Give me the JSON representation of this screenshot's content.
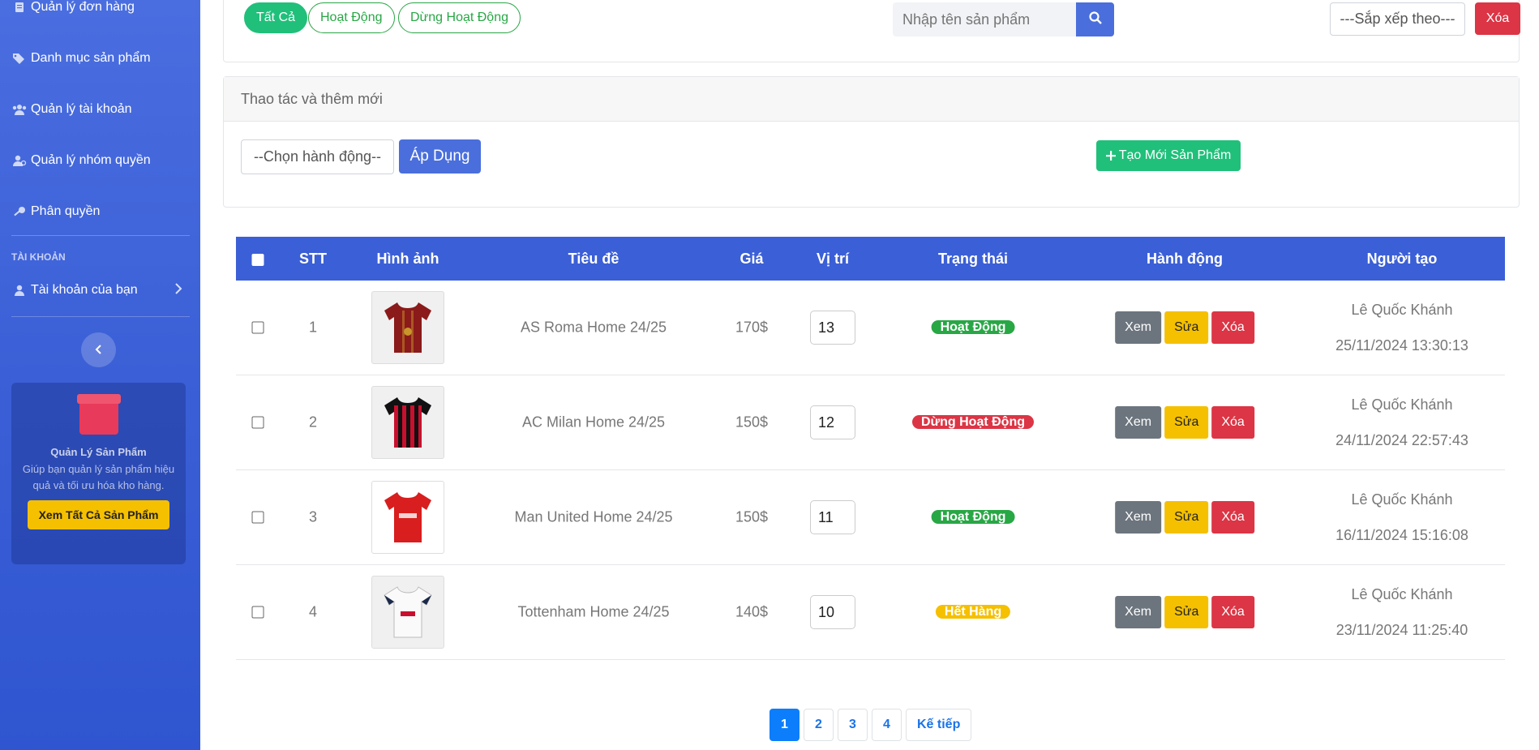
{
  "sidebar": {
    "items": [
      {
        "label": "Quản lý đơn hàng",
        "icon": "order-icon"
      },
      {
        "label": "Danh mục sản phẩm",
        "icon": "tags-icon"
      },
      {
        "label": "Quản lý tài khoản",
        "icon": "users-icon"
      },
      {
        "label": "Quản lý nhóm quyền",
        "icon": "user-group-icon"
      },
      {
        "label": "Phân quyền",
        "icon": "key-icon"
      }
    ],
    "section_label": "TÀI KHOẢN",
    "account_item": "Tài khoản của bạn",
    "collapse_icon": "chevron-left-icon",
    "promo": {
      "title": "Quản Lý Sản Phẩm",
      "description": "Giúp bạn quản lý sản phẩm hiệu quả và tối ưu hóa kho hàng.",
      "button": "Xem Tất Cả Sản Phẩm"
    }
  },
  "filter": {
    "status_buttons": [
      "Tất Cả",
      "Hoạt Động",
      "Dừng Hoạt Động"
    ],
    "active_status": "Tất Cả",
    "search_placeholder": "Nhập tên sản phẩm",
    "sort_placeholder": "---Sắp xếp theo---",
    "clear_label": "Xóa"
  },
  "actions": {
    "heading": "Thao tác và thêm mới",
    "select_placeholder": "--Chọn hành động--",
    "apply_label": "Áp Dụng",
    "create_label": "Tạo Mới Sản Phẩm"
  },
  "table": {
    "headers": [
      "STT",
      "Hình ảnh",
      "Tiêu đề",
      "Giá",
      "Vị trí",
      "Trạng thái",
      "Hành động",
      "Người tạo"
    ],
    "action_labels": {
      "view": "Xem",
      "edit": "Sửa",
      "delete": "Xóa"
    },
    "rows": [
      {
        "stt": "1",
        "title": "AS Roma Home 24/25",
        "price": "170$",
        "position": "13",
        "status": "Hoạt Động",
        "status_color": "#28a745",
        "creator": "Lê Quốc Khánh",
        "created": "25/11/2024 13:30:13",
        "shirt_colors": [
          "#8b1a1a",
          "#c9962a"
        ]
      },
      {
        "stt": "2",
        "title": "AC Milan Home 24/25",
        "price": "150$",
        "position": "12",
        "status": "Dừng Hoạt Động",
        "status_color": "#dc3545",
        "creator": "Lê Quốc Khánh",
        "created": "24/11/2024 22:57:43",
        "shirt_colors": [
          "#c8102e",
          "#111111"
        ]
      },
      {
        "stt": "3",
        "title": "Man United Home 24/25",
        "price": "150$",
        "position": "11",
        "status": "Hoạt Động",
        "status_color": "#28a745",
        "creator": "Lê Quốc Khánh",
        "created": "16/11/2024 15:16:08",
        "shirt_colors": [
          "#d81e1e",
          "#d81e1e"
        ]
      },
      {
        "stt": "4",
        "title": "Tottenham Home 24/25",
        "price": "140$",
        "position": "10",
        "status": "Hết Hàng",
        "status_color": "#f5c000",
        "creator": "Lê Quốc Khánh",
        "created": "23/11/2024 11:25:40",
        "shirt_colors": [
          "#ffffff",
          "#1b2a4a"
        ]
      }
    ]
  },
  "pagination": {
    "pages": [
      "1",
      "2",
      "3",
      "4"
    ],
    "current": "1",
    "next_label": "Kế tiếp"
  }
}
